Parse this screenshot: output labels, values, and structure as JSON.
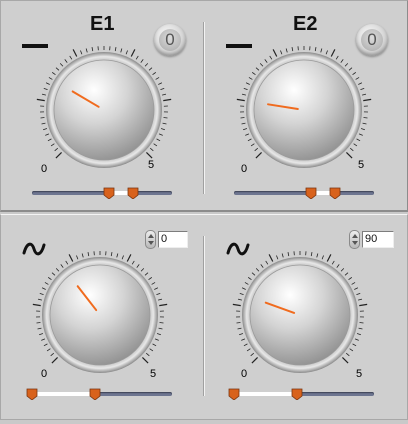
{
  "panels": {
    "top_left": {
      "title": "E1",
      "zero_indicator": "0",
      "mode_icon": "dc-line-icon",
      "scale": {
        "min": "0",
        "max": "5"
      },
      "knob_value": 1.4,
      "slider": {
        "low": 0.55,
        "high": 0.72
      }
    },
    "top_right": {
      "title": "E2",
      "zero_indicator": "0",
      "mode_icon": "dc-line-icon",
      "scale": {
        "min": "0",
        "max": "5"
      },
      "knob_value": 1.0,
      "slider": {
        "low": 0.55,
        "high": 0.72
      }
    },
    "bottom_left": {
      "mode_icon": "ac-tilde-icon",
      "phase_value": "0",
      "scale": {
        "min": "0",
        "max": "5"
      },
      "knob_value": 1.8,
      "slider": {
        "low": 0.0,
        "high": 0.45
      }
    },
    "bottom_right": {
      "mode_icon": "ac-tilde-icon",
      "phase_value": "90",
      "scale": {
        "min": "0",
        "max": "5"
      },
      "knob_value": 1.2,
      "slider": {
        "low": 0.0,
        "high": 0.45
      }
    }
  },
  "colors": {
    "needle": "#f06b1e",
    "slider_thumb": "#d8621c",
    "panel_bg": "#cfcfcf",
    "track": "#6d7590"
  }
}
